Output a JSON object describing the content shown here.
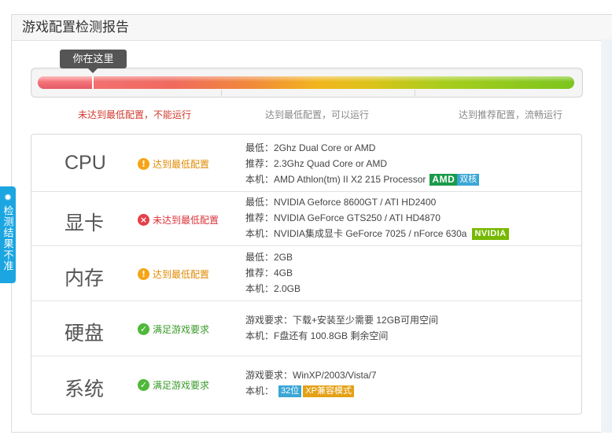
{
  "header": {
    "title": "游戏配置检测报告"
  },
  "indicator": {
    "you_are_here": "你在这里",
    "progress": 0.1
  },
  "levels": [
    {
      "label": "未达到最低配置，不能运行"
    },
    {
      "label": "达到最低配置，可以运行"
    },
    {
      "label": "达到推荐配置，流畅运行"
    }
  ],
  "rows": [
    {
      "name": "CPU",
      "status": "达到最低配置",
      "status_type": "warn",
      "lines": [
        "最低：2Ghz Dual Core or AMD",
        "推荐：2.3Ghz Quad Core or AMD",
        "本机：AMD Athlon(tm) II X2 215 Processor"
      ],
      "badges": [
        "AMD",
        "双核"
      ]
    },
    {
      "name": "显卡",
      "status": "未达到最低配置",
      "status_type": "err",
      "lines": [
        "最低：NVIDIA Geforce 8600GT / ATI HD2400",
        "推荐：NVIDIA GeForce GTS250 / ATI HD4870",
        "本机：NVIDIA集成显卡 GeForce 7025 / nForce 630a"
      ],
      "badges": [
        "NVIDIA"
      ]
    },
    {
      "name": "内存",
      "status": "达到最低配置",
      "status_type": "warn",
      "lines": [
        "最低：2GB",
        "推荐：4GB",
        "本机：2.0GB"
      ]
    },
    {
      "name": "硬盘",
      "status": "满足游戏要求",
      "status_type": "ok",
      "lines": [
        "游戏要求：下载+安装至少需要 12GB可用空间",
        "本机：F盘还有 100.8GB 剩余空间"
      ]
    },
    {
      "name": "系统",
      "status": "满足游戏要求",
      "status_type": "ok",
      "lines": [
        "游戏要求：WinXP/2003/Vista/7",
        "本机："
      ],
      "badges": [
        "32位",
        "XP兼容模式"
      ]
    }
  ],
  "side_tab": {
    "label": "检测结果不准",
    "icon": "bug-icon"
  },
  "colors": {
    "accent": "#1ba6e2",
    "warn": "#f6a417",
    "error": "#e5414a",
    "ok": "#4fb83a"
  }
}
